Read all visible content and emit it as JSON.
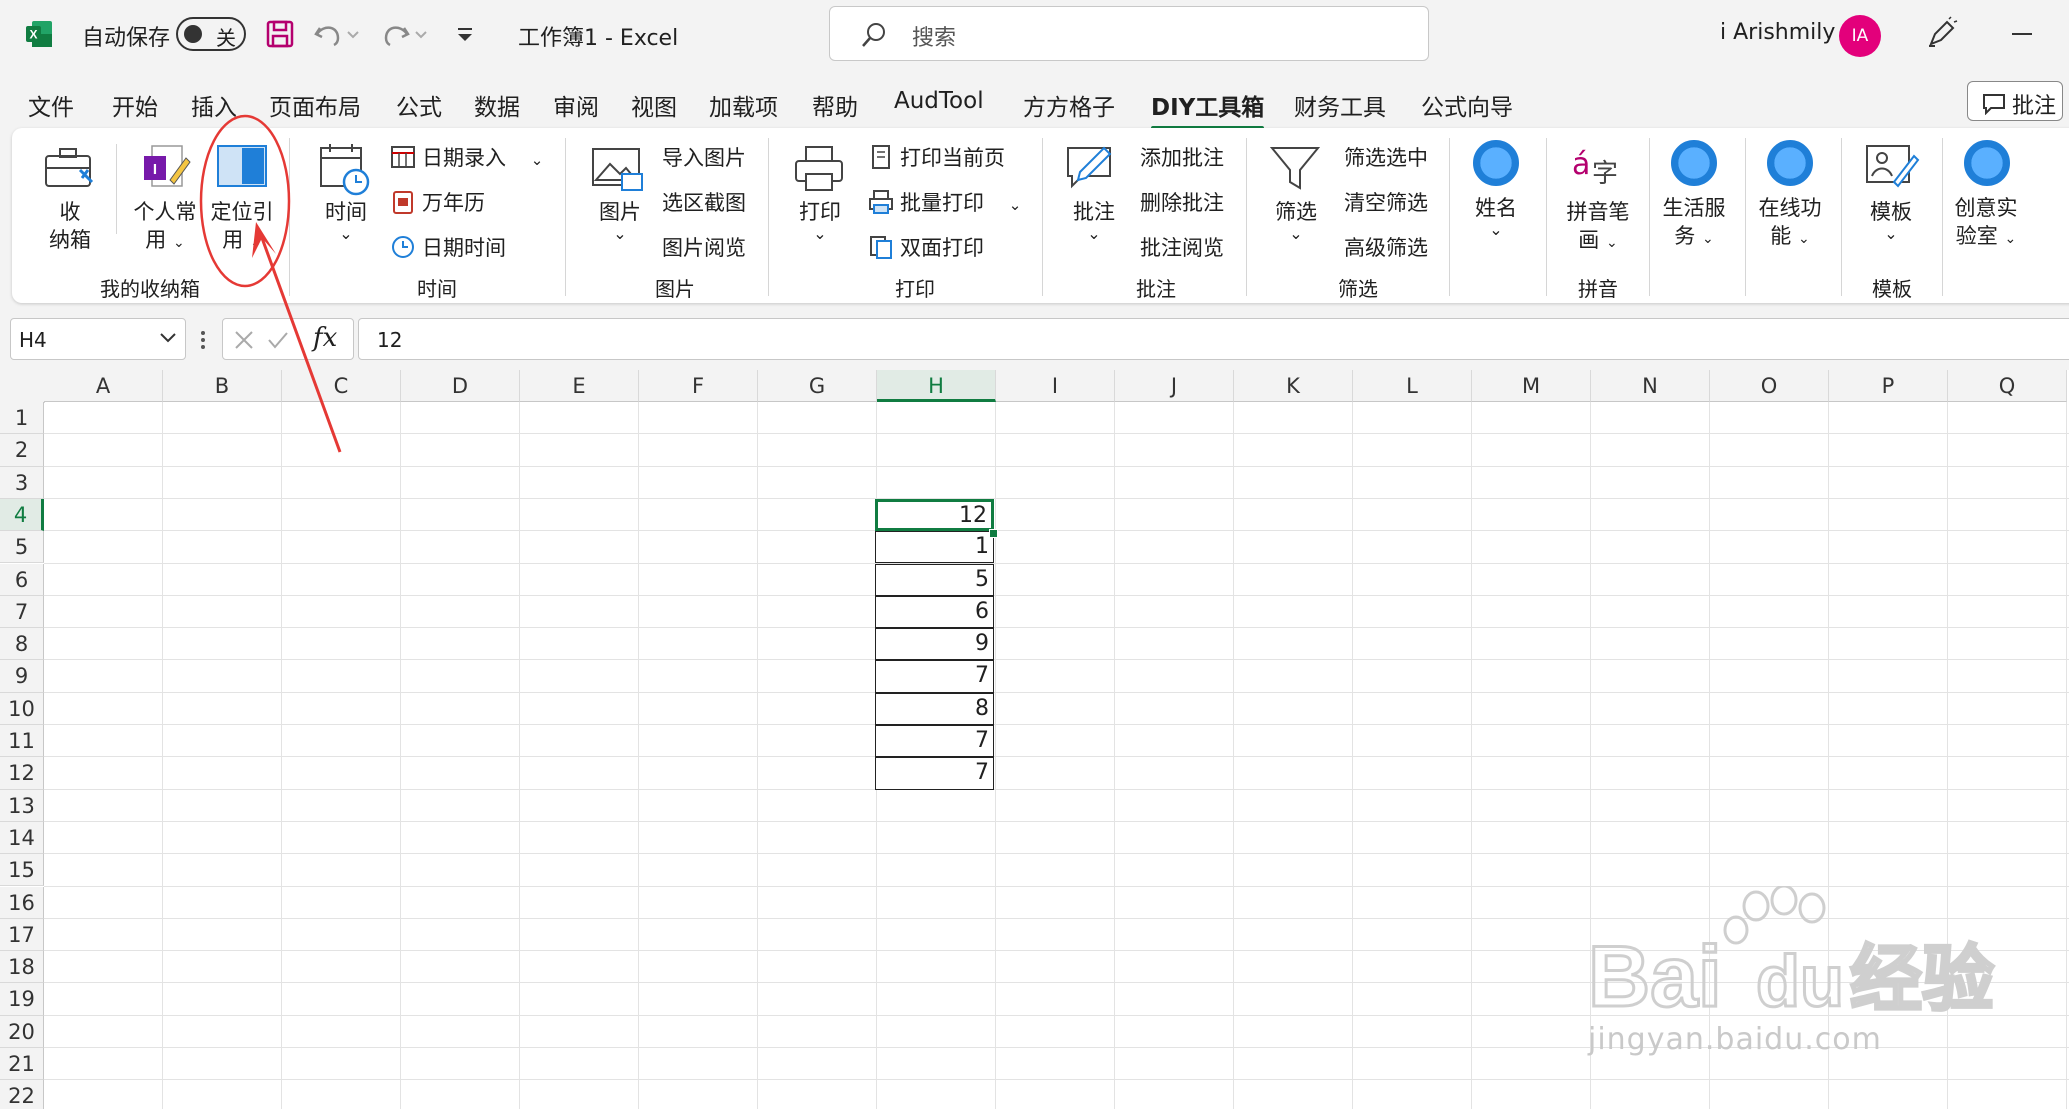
{
  "titlebar": {
    "autosave_label": "自动保存",
    "autosave_state": "关",
    "document_title": "工作簿1  -  Excel",
    "search_placeholder": "搜索",
    "user_name": "i Arishmily",
    "avatar_initials": "IA"
  },
  "menu": {
    "tabs": [
      "文件",
      "开始",
      "插入",
      "页面布局",
      "公式",
      "数据",
      "审阅",
      "视图",
      "加载项",
      "帮助",
      "AudTool",
      "方方格子",
      "DIY工具箱",
      "财务工具",
      "公式向导"
    ],
    "active_tab": "DIY工具箱",
    "comment_button": "批注"
  },
  "ribbon": {
    "storage": {
      "btn_storage": [
        "收",
        "纳箱"
      ],
      "btn_personal": [
        "个人常",
        "用"
      ],
      "btn_locate": [
        "定位引",
        "用"
      ],
      "label": "我的收纳箱"
    },
    "time": {
      "btn_time": "时间",
      "date_entry": "日期录入",
      "perpetual_calendar": "万年历",
      "date_time": "日期时间",
      "label": "时间"
    },
    "picture": {
      "btn_picture": "图片",
      "import_picture": "导入图片",
      "region_screenshot": "选区截图",
      "picture_browse": "图片阅览",
      "label": "图片"
    },
    "print": {
      "btn_print": "打印",
      "print_current": "打印当前页",
      "batch_print": "批量打印",
      "duplex_print": "双面打印",
      "label": "打印"
    },
    "comment": {
      "btn_comment": "批注",
      "add_comment": "添加批注",
      "delete_comment": "删除批注",
      "browse_comment": "批注阅览",
      "label": "批注"
    },
    "filter": {
      "btn_filter": "筛选",
      "filter_selected": "筛选选中",
      "clear_filter": "清空筛选",
      "advanced_filter": "高级筛选",
      "label": "筛选"
    },
    "name": {
      "btn_name": "姓名"
    },
    "pinyin": {
      "btn_stroke": [
        "拼音笔",
        "画"
      ],
      "label": "拼音"
    },
    "life": {
      "btn_life": [
        "生活服",
        "务"
      ]
    },
    "online": {
      "btn_online": [
        "在线功",
        "能"
      ]
    },
    "template": {
      "btn_template": "模板",
      "label": "模板"
    },
    "creative": {
      "btn_creative": [
        "创意实",
        "验室"
      ]
    }
  },
  "formula_bar": {
    "name_box": "H4",
    "fx": "fx",
    "value": "12"
  },
  "sheet": {
    "columns": [
      "A",
      "B",
      "C",
      "D",
      "E",
      "F",
      "G",
      "H",
      "I",
      "J",
      "K",
      "L",
      "M",
      "N",
      "O",
      "P",
      "Q"
    ],
    "rows": [
      "1",
      "2",
      "3",
      "4",
      "5",
      "6",
      "7",
      "8",
      "9",
      "10",
      "11",
      "12",
      "13",
      "14",
      "15",
      "16",
      "17",
      "18",
      "19",
      "20",
      "21",
      "22"
    ],
    "selected_column": "H",
    "selected_row": "4",
    "cells": [
      {
        "ref": "H4",
        "value": "12"
      },
      {
        "ref": "H5",
        "value": "1"
      },
      {
        "ref": "H6",
        "value": "5"
      },
      {
        "ref": "H7",
        "value": "6"
      },
      {
        "ref": "H8",
        "value": "9"
      },
      {
        "ref": "H9",
        "value": "7"
      },
      {
        "ref": "H10",
        "value": "8"
      },
      {
        "ref": "H11",
        "value": "7"
      },
      {
        "ref": "H12",
        "value": "7"
      }
    ]
  },
  "watermark": {
    "brand": "Bai",
    "brand2": "du",
    "cn": "经验",
    "url": "jingyan.baidu.com"
  },
  "colors": {
    "accent": "#107c41",
    "annotation": "#e53935",
    "avatar": "#e3007b"
  }
}
